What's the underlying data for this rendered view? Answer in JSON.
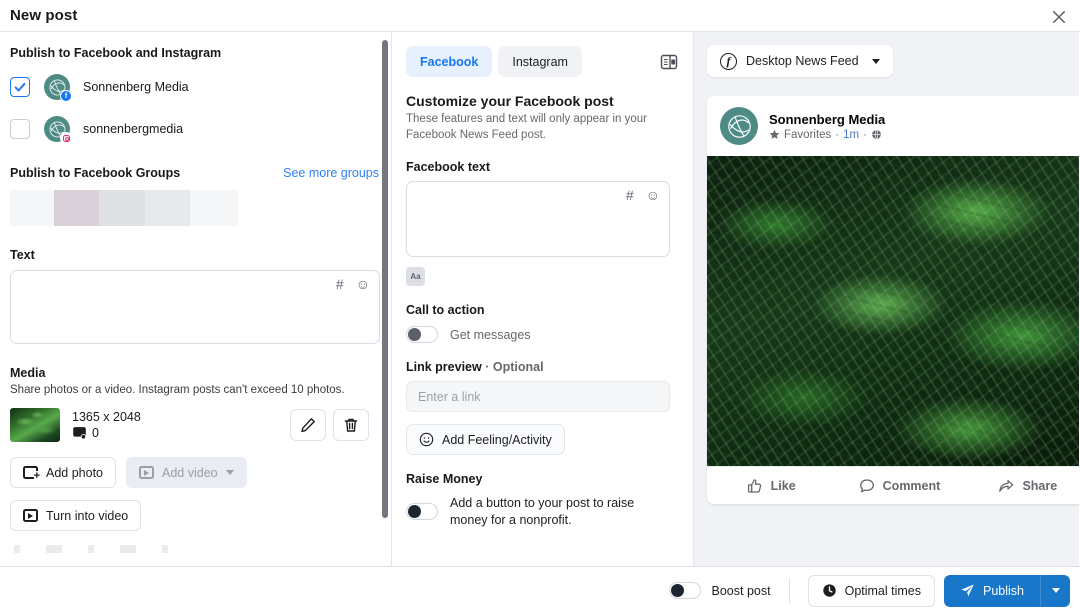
{
  "header": {
    "title": "New post",
    "close_icon": "close-icon"
  },
  "left": {
    "publish_accounts_title": "Publish to Facebook and Instagram",
    "accounts": [
      {
        "name": "Sonnenberg Media",
        "platform": "facebook",
        "checked": true
      },
      {
        "name": "sonnenbergmedia",
        "platform": "instagram",
        "checked": false
      }
    ],
    "groups_title": "Publish to Facebook Groups",
    "see_more_groups": "See more groups",
    "text_label": "Text",
    "text_value": "",
    "hash_icon": "#",
    "emoji_icon": "☺",
    "media_label": "Media",
    "media_sub": "Share photos or a video. Instagram posts can't exceed 10 photos.",
    "media_dimensions": "1365 x 2048",
    "media_alt_count": "0",
    "edit_icon": "pencil-icon",
    "delete_icon": "trash-icon",
    "add_photo": "Add photo",
    "add_video": "Add video",
    "turn_into_video": "Turn into video"
  },
  "middle": {
    "tabs": [
      {
        "label": "Facebook",
        "active": true
      },
      {
        "label": "Instagram",
        "active": false
      }
    ],
    "layout_icon": "panel-layout-icon",
    "heading": "Customize your Facebook post",
    "subheading": "These features and text will only appear in your Facebook News Feed post.",
    "fb_text_label": "Facebook text",
    "fb_text_value": "",
    "hash_icon": "#",
    "emoji_icon": "☺",
    "aa_label": "Aa",
    "cta_title": "Call to action",
    "cta_toggle_label": "Get messages",
    "cta_toggle_on": false,
    "link_preview_title": "Link preview",
    "link_preview_optional": "· Optional",
    "link_placeholder": "Enter a link",
    "link_value": "",
    "feeling_button": "Add Feeling/Activity",
    "raise_money_title": "Raise Money",
    "raise_money_text": "Add a button to your post to raise money for a nonprofit.",
    "raise_money_on": false
  },
  "right": {
    "feed_selector": "Desktop News Feed",
    "post_author": "Sonnenberg Media",
    "post_audience": "Favorites",
    "post_time": "1m",
    "post_privacy_icon": "globe-icon",
    "actions": [
      {
        "label": "Like",
        "icon": "thumbs-up-icon"
      },
      {
        "label": "Comment",
        "icon": "comment-bubble-icon"
      },
      {
        "label": "Share",
        "icon": "share-arrow-icon"
      }
    ]
  },
  "footer": {
    "boost_label": "Boost post",
    "boost_on": false,
    "optimal_times": "Optimal times",
    "publish": "Publish",
    "publish_caret_icon": "chevron-down-icon"
  },
  "colors": {
    "accent_blue": "#1877f2",
    "publish_blue": "#1877c9",
    "link_blue": "#2d7ff9",
    "avatar_teal": "#4e8b85",
    "panel_grey": "#f0f2f5"
  }
}
